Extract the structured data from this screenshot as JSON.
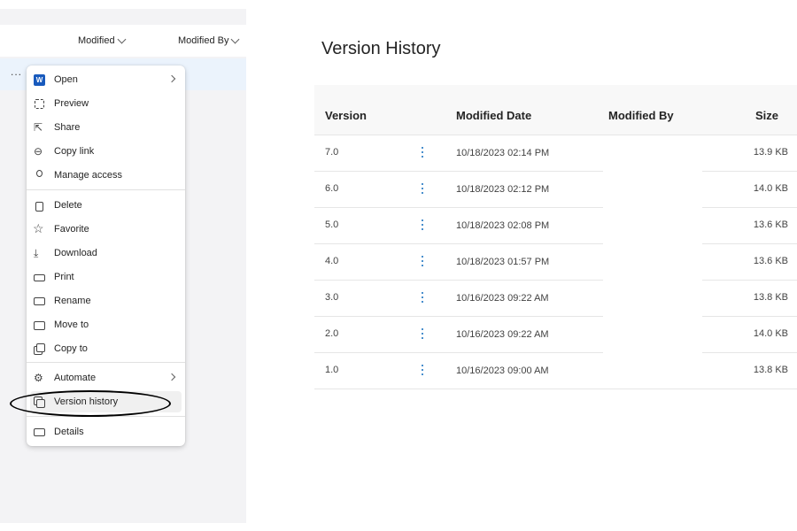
{
  "file_list": {
    "columns": {
      "modified": "Modified",
      "modified_by": "Modified By"
    },
    "row_more": "..."
  },
  "context_menu": {
    "items": [
      {
        "label": "Open",
        "icon": "word-icon",
        "submenu": true
      },
      {
        "label": "Preview",
        "icon": "preview-icon"
      },
      {
        "label": "Share",
        "icon": "share-icon"
      },
      {
        "label": "Copy link",
        "icon": "link-icon"
      },
      {
        "label": "Manage access",
        "icon": "manage-access-icon"
      },
      {
        "label": "Delete",
        "icon": "trash-icon"
      },
      {
        "label": "Favorite",
        "icon": "star-icon"
      },
      {
        "label": "Download",
        "icon": "download-icon"
      },
      {
        "label": "Print",
        "icon": "print-icon"
      },
      {
        "label": "Rename",
        "icon": "rename-icon"
      },
      {
        "label": "Move to",
        "icon": "move-icon"
      },
      {
        "label": "Copy to",
        "icon": "copy-icon"
      },
      {
        "label": "Automate",
        "icon": "automate-icon",
        "submenu": true
      },
      {
        "label": "Version history",
        "icon": "version-history-icon",
        "highlighted": true
      },
      {
        "label": "Details",
        "icon": "details-icon"
      }
    ],
    "accent_color": "#185abd"
  },
  "version_history": {
    "title": "Version History",
    "headers": {
      "version": "Version",
      "modified_date": "Modified Date",
      "modified_by": "Modified By",
      "size": "Size"
    },
    "rows": [
      {
        "version": "7.0",
        "modified_date": "10/18/2023 02:14 PM",
        "modified_by": "",
        "size": "13.9 KB"
      },
      {
        "version": "6.0",
        "modified_date": "10/18/2023 02:12 PM",
        "modified_by": "",
        "size": "14.0 KB"
      },
      {
        "version": "5.0",
        "modified_date": "10/18/2023 02:08 PM",
        "modified_by": "",
        "size": "13.6 KB"
      },
      {
        "version": "4.0",
        "modified_date": "10/18/2023 01:57 PM",
        "modified_by": "",
        "size": "13.6 KB"
      },
      {
        "version": "3.0",
        "modified_date": "10/16/2023 09:22 AM",
        "modified_by": "",
        "size": "13.8 KB"
      },
      {
        "version": "2.0",
        "modified_date": "10/16/2023 09:22 AM",
        "modified_by": "",
        "size": "14.0 KB"
      },
      {
        "version": "1.0",
        "modified_date": "10/16/2023 09:00 AM",
        "modified_by": "",
        "size": "13.8 KB"
      }
    ],
    "kebab_color": "#0f6cbd"
  }
}
